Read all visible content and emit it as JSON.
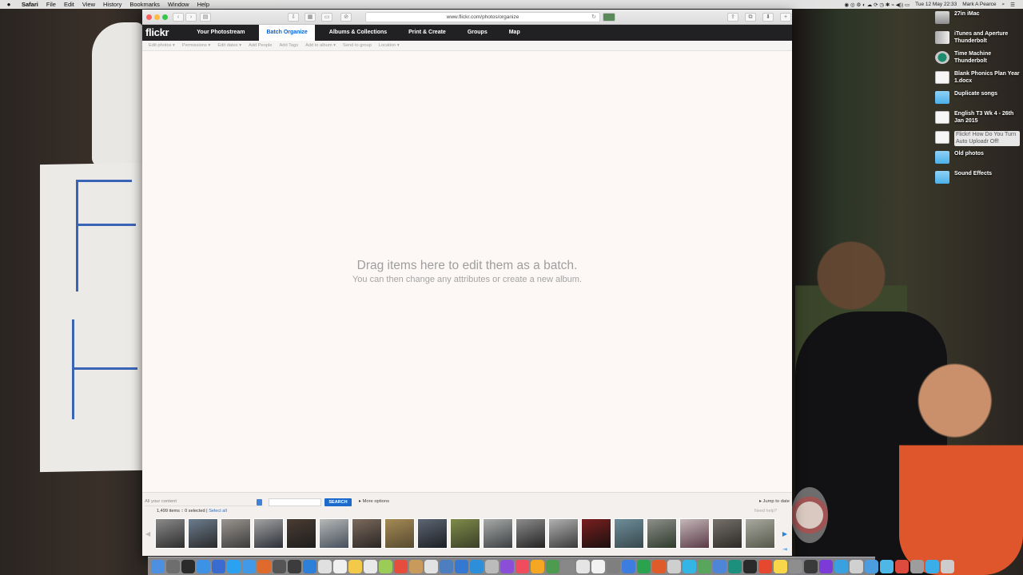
{
  "menubar": {
    "apple": "",
    "items": [
      "Safari",
      "File",
      "Edit",
      "View",
      "History",
      "Bookmarks",
      "Window",
      "Help"
    ],
    "clock": "Tue 12 May  22:33",
    "user": "Mark A Pearce"
  },
  "desktop": {
    "icons": [
      {
        "label": "27in iMac",
        "kind": "drive"
      },
      {
        "label": "iTunes and Aperture Thunderbolt",
        "kind": "tb"
      },
      {
        "label": "Time Machine Thunderbolt",
        "kind": "tm"
      },
      {
        "label": "Blank Phonics Plan Year 1.docx",
        "kind": "doc"
      },
      {
        "label": "Duplicate songs",
        "kind": "folder"
      },
      {
        "label": "English T3 Wk 4 - 26th Jan 2015",
        "kind": "doc"
      },
      {
        "label": "Flickr! How Do You Turn Auto Uploadr Off!",
        "kind": "doc",
        "selected": true
      },
      {
        "label": "Old photos",
        "kind": "folder"
      },
      {
        "label": "Sound Effects",
        "kind": "folder"
      }
    ]
  },
  "browser": {
    "url": "www.flickr.com/photos/organize",
    "back_icon": "‹",
    "forward_icon": "›",
    "sidebar_icon": "▤",
    "reload_icon": "↻"
  },
  "flickr": {
    "logo": "flickr",
    "tabs": [
      {
        "label": "Your Photostream",
        "active": false
      },
      {
        "label": "Batch Organize",
        "active": true
      },
      {
        "label": "Albums & Collections",
        "active": false
      },
      {
        "label": "Print & Create",
        "active": false
      },
      {
        "label": "Groups",
        "active": false
      },
      {
        "label": "Map",
        "active": false
      }
    ],
    "subnav": [
      "Edit photos ▾",
      "Permissions ▾",
      "Edit dates ▾",
      "Add People",
      "Add Tags",
      "Add to album ▾",
      "Send to group",
      "Location ▾"
    ],
    "drop_title": "Drag items here to edit them as a batch.",
    "drop_sub": "You can then change any attributes or create a new album.",
    "filter": {
      "content_select": "All your content",
      "search_placeholder": "",
      "search_button": "SEARCH",
      "more_options": "▸ More options",
      "jump_to_date": "▸ Jump to date"
    },
    "count_text": "1,499 items :: 0 selected | ",
    "select_all": "Select all",
    "need_help": "Need help?"
  },
  "thumbnails": [
    {
      "c1": "#8a8a8a",
      "c2": "#2d2d2d"
    },
    {
      "c1": "#6b7c8e",
      "c2": "#2a2a2a"
    },
    {
      "c1": "#9a9590",
      "c2": "#3b3b3b"
    },
    {
      "c1": "#a3a3a3",
      "c2": "#2b2f36"
    },
    {
      "c1": "#4a3c32",
      "c2": "#1e1e1e"
    },
    {
      "c1": "#b7b7b7",
      "c2": "#45505c"
    },
    {
      "c1": "#7c6a5c",
      "c2": "#2a2624"
    },
    {
      "c1": "#a58a55",
      "c2": "#574a30"
    },
    {
      "c1": "#5d6673",
      "c2": "#1c1f24"
    },
    {
      "c1": "#7f8b4a",
      "c2": "#3a3f28"
    },
    {
      "c1": "#a8aaa8",
      "c2": "#3c4043"
    },
    {
      "c1": "#8c8c8c",
      "c2": "#232323"
    },
    {
      "c1": "#b1b1b1",
      "c2": "#3a3a3a"
    },
    {
      "c1": "#7a1f1f",
      "c2": "#1b1010"
    },
    {
      "c1": "#6d8d9a",
      "c2": "#39484c"
    },
    {
      "c1": "#8d8f8a",
      "c2": "#2e3a2b"
    },
    {
      "c1": "#c3b7b9",
      "c2": "#5b3a47"
    },
    {
      "c1": "#75706a",
      "c2": "#2d2a27"
    },
    {
      "c1": "#a9a9a0",
      "c2": "#54584a"
    }
  ],
  "dock": {
    "icons": [
      "#4d8fe0",
      "#6e6e6e",
      "#2b2b2b",
      "#3e92e6",
      "#3a6bd1",
      "#2aa2f1",
      "#4299e8",
      "#e06a2b",
      "#555",
      "#3c3c3c",
      "#2d7fd7",
      "#e0e0e0",
      "#f0f0f0",
      "#f3c949",
      "#e9e9e9",
      "#9acc57",
      "#e64d3d",
      "#c89a5c",
      "#e2e2e2",
      "#4d7ec0",
      "#3478d1",
      "#2d8fd9",
      "#bbb",
      "#8a4fd6",
      "#f04c5d",
      "#f5a623",
      "#4c9b4f",
      "#888",
      "#e5e5e5",
      "#f2f2f2",
      "#7f7f7f",
      "#3d7de0",
      "#2ba34e",
      "#e05b2a",
      "#cfcfcf",
      "#33b5e5",
      "#58a65c",
      "#4f85d6",
      "#1d8f7d",
      "#2a2a2a",
      "#e5482f",
      "#f7d64a",
      "#8e8e8e",
      "#3a3a3a",
      "#7c3ad6",
      "#3aa1e0",
      "#d0d0d0",
      "#4b9de0",
      "#4db7e8",
      "#dc4b3e",
      "#9d9d9d",
      "#3baeea",
      "#cccccc"
    ]
  }
}
